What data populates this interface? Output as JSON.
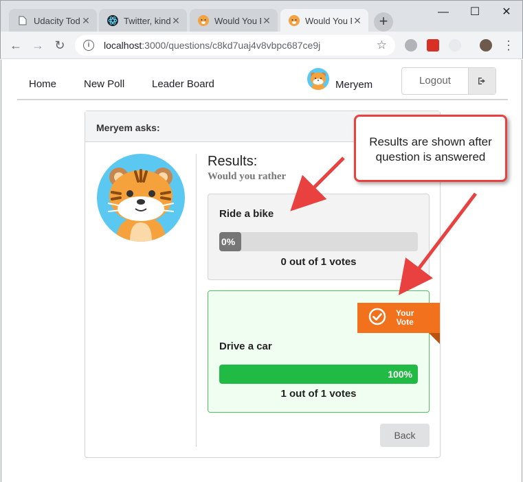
{
  "browser": {
    "tabs": [
      {
        "title": "Udacity Todo",
        "active": false,
        "icon": "doc-icon"
      },
      {
        "title": "Twitter, kind",
        "active": false,
        "icon": "react-icon"
      },
      {
        "title": "Would You R",
        "active": false,
        "icon": "tiger-icon"
      },
      {
        "title": "Would You R",
        "active": true,
        "icon": "tiger-icon"
      }
    ],
    "new_tab": "+",
    "url_host": "localhost",
    "url_rest": ":3000/questions/c8kd7uaj4v8vbpc687ce9j"
  },
  "nav": {
    "links": [
      "Home",
      "New Poll",
      "Leader Board"
    ],
    "user": "Meryem",
    "logout": "Logout"
  },
  "card": {
    "header": "Meryem asks:",
    "results_title": "Results:",
    "results_subtitle": "Would you rather",
    "options": [
      {
        "label": "Ride a bike",
        "percent_text": "0%",
        "percent": 0,
        "votes_text": "0 out of 1 votes",
        "your_vote": false
      },
      {
        "label": "Drive a car",
        "percent_text": "100%",
        "percent": 100,
        "votes_text": "1 out of 1 votes",
        "your_vote": true
      }
    ],
    "your_vote_line1": "Your",
    "your_vote_line2": "Vote",
    "back": "Back"
  },
  "annotation": {
    "line1": "Results are shown after",
    "line2": "question is answered"
  },
  "colors": {
    "accent_orange": "#f2711c",
    "green": "#21ba45",
    "annotation_red": "#e8413f"
  }
}
